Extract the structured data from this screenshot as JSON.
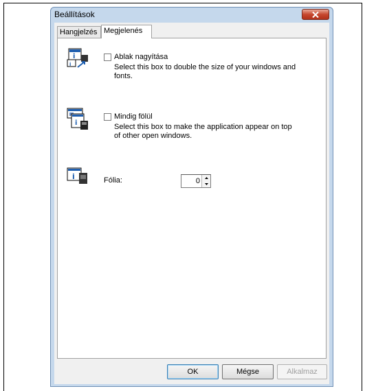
{
  "dialog": {
    "title": "Beállítások",
    "close_label": "Close"
  },
  "tabs": [
    {
      "label": "Hangjelzés",
      "active": false
    },
    {
      "label": "Megjelenés",
      "active": true
    }
  ],
  "options": {
    "magnify": {
      "label": "Ablak nagyítása",
      "checked": false,
      "description": "Select this box to double the size of your windows and fonts.",
      "icon": "magnify-window-icon"
    },
    "always_on_top": {
      "label": "Mindig fölül",
      "checked": false,
      "description": "Select this box to make the application appear on top of other open windows.",
      "icon": "stacked-windows-icon"
    },
    "foil": {
      "label": "Fólia:",
      "value": "0",
      "icon": "info-foil-icon"
    }
  },
  "buttons": {
    "ok": "OK",
    "cancel": "Mégse",
    "apply": "Alkalmaz",
    "apply_enabled": false
  },
  "colors": {
    "title_bar": "#c5d8ec",
    "close_button": "#c7472e",
    "icon_blue": "#1f5fb0"
  }
}
